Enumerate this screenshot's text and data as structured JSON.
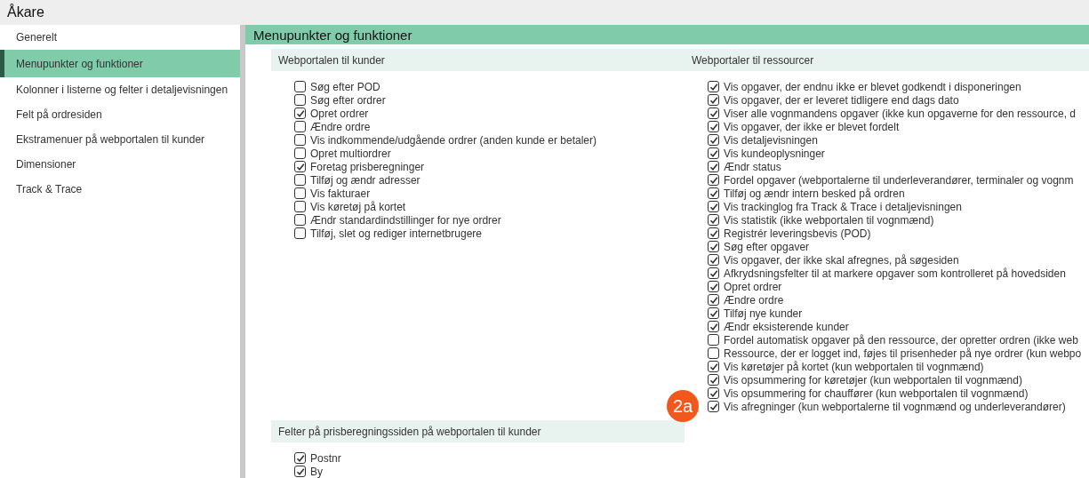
{
  "window": {
    "title": "Åkare"
  },
  "sidebar": {
    "items": [
      {
        "label": "Generelt",
        "selected": false
      },
      {
        "label": "Menupunkter og funktioner",
        "selected": true
      },
      {
        "label": "Kolonner i listerne og felter i detaljevisningen",
        "selected": false
      },
      {
        "label": "Felt på ordresiden",
        "selected": false
      },
      {
        "label": "Ekstramenuer på webportalen til kunder",
        "selected": false
      },
      {
        "label": "Dimensioner",
        "selected": false
      },
      {
        "label": "Track & Trace",
        "selected": false
      }
    ]
  },
  "main": {
    "heading": "Menupunkter og funktioner",
    "sections": [
      {
        "title": "Webportalen til kunder",
        "items": [
          {
            "label": "Søg efter POD",
            "checked": false
          },
          {
            "label": "Søg efter ordrer",
            "checked": false
          },
          {
            "label": "Opret ordrer",
            "checked": true
          },
          {
            "label": "Ændre ordre",
            "checked": false
          },
          {
            "label": "Vis indkommende/udgående ordrer (anden kunde er betaler)",
            "checked": false
          },
          {
            "label": "Opret multiordrer",
            "checked": false
          },
          {
            "label": "Foretag prisberegninger",
            "checked": true
          },
          {
            "label": "Tilføj og ændr adresser",
            "checked": false
          },
          {
            "label": "Vis fakturaer",
            "checked": false
          },
          {
            "label": "Vis køretøj på kortet",
            "checked": false
          },
          {
            "label": "Ændr standardindstillinger for nye ordrer",
            "checked": false
          },
          {
            "label": "Tilføj, slet og rediger internetbrugere",
            "checked": false
          }
        ]
      },
      {
        "title": "Webportaler til ressourcer",
        "items": [
          {
            "label": "Vis opgaver, der endnu ikke er blevet godkendt i disponeringen",
            "checked": true
          },
          {
            "label": "Vis opgaver, der er leveret tidligere end dags dato",
            "checked": true
          },
          {
            "label": "Viser alle vognmandens opgaver (ikke kun opgaverne for den ressource, d",
            "checked": true
          },
          {
            "label": "Vis opgaver, der ikke er blevet fordelt",
            "checked": true
          },
          {
            "label": "Vis detaljevisningen",
            "checked": true
          },
          {
            "label": "Vis kundeoplysninger",
            "checked": true
          },
          {
            "label": "Ændr status",
            "checked": true
          },
          {
            "label": "Fordel opgaver (webportalerne til underleverandører, terminaler og vognm",
            "checked": true
          },
          {
            "label": "Tilføj og ændr intern besked på ordren",
            "checked": true
          },
          {
            "label": "Vis trackinglog fra Track & Trace i detaljevisningen",
            "checked": true
          },
          {
            "label": "Vis statistik (ikke webportalen til vognmænd)",
            "checked": true
          },
          {
            "label": "Registrér leveringsbevis (POD)",
            "checked": true
          },
          {
            "label": "Søg efter opgaver",
            "checked": true
          },
          {
            "label": "Vis opgaver, der ikke skal afregnes, på søgesiden",
            "checked": true
          },
          {
            "label": "Afkrydsningsfelter til at markere opgaver som kontrolleret på hovedsiden",
            "checked": true
          },
          {
            "label": "Opret ordrer",
            "checked": true
          },
          {
            "label": "Ændre ordre",
            "checked": true
          },
          {
            "label": "Tilføj nye kunder",
            "checked": true
          },
          {
            "label": "Ændr eksisterende kunder",
            "checked": true
          },
          {
            "label": "Fordel automatisk opgaver på den ressource, der opretter ordren (ikke web",
            "checked": false
          },
          {
            "label": "Ressource, der er logget ind, føjes til prisenheder på nye ordrer (kun webpo",
            "checked": false
          },
          {
            "label": "Vis køretøjer på kortet (kun webportalen til vognmænd)",
            "checked": true
          },
          {
            "label": "Vis opsummering for køretøjer (kun webportalen til vognmænd)",
            "checked": true
          },
          {
            "label": "Vis opsummering for chauffører (kun webportalen til vognmænd)",
            "checked": true
          },
          {
            "label": "Vis afregninger (kun webportalerne til vognmænd og underleverandører)",
            "checked": true
          }
        ]
      },
      {
        "title": "Felter på prisberegningssiden på webportalen til kunder",
        "items": [
          {
            "label": "Postnr",
            "checked": true
          },
          {
            "label": "By",
            "checked": true
          }
        ]
      }
    ],
    "badge": {
      "label": "2a"
    }
  }
}
